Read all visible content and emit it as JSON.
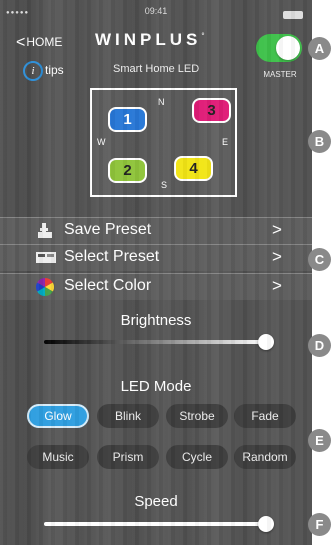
{
  "status_bar": {
    "time": "09:41",
    "signal": "●●●●●"
  },
  "header": {
    "back_label": "HOME",
    "brand": "WINPLUS",
    "brand_mark": "°",
    "master_label": "MASTER",
    "master_on": true
  },
  "subheader": {
    "tips_label": "tips",
    "subtitle": "Smart Home LED"
  },
  "compass": {
    "directions": {
      "north": "N",
      "south": "S",
      "east": "E",
      "west": "W"
    },
    "zones": [
      {
        "label": "1",
        "color": "#2777d6",
        "text_color": "#ffffff"
      },
      {
        "label": "2",
        "color": "#8fc43a",
        "text_color": "#222222"
      },
      {
        "label": "3",
        "color": "#e01c77",
        "text_color": "#222222"
      },
      {
        "label": "4",
        "color": "#f2e516",
        "text_color": "#222222"
      }
    ]
  },
  "menu": [
    {
      "label": "Save Preset",
      "arrow": ">",
      "icon": "save-preset-icon"
    },
    {
      "label": "Select Preset",
      "arrow": ">",
      "icon": "select-preset-icon"
    },
    {
      "label": "Select Color",
      "arrow": ">",
      "icon": "color-wheel-icon"
    }
  ],
  "brightness": {
    "title": "Brightness",
    "value": 1.0
  },
  "led_mode": {
    "title": "LED Mode",
    "modes": [
      "Glow",
      "Blink",
      "Strobe",
      "Fade",
      "Music",
      "Prism",
      "Cycle",
      "Random"
    ],
    "selected": "Glow"
  },
  "speed": {
    "title": "Speed",
    "value": 1.0
  },
  "callouts": [
    "A",
    "B",
    "C",
    "D",
    "E",
    "F"
  ],
  "colors": {
    "accent": "#2e9ee0",
    "toggle_on": "#3ec14a",
    "background": "#525252"
  }
}
